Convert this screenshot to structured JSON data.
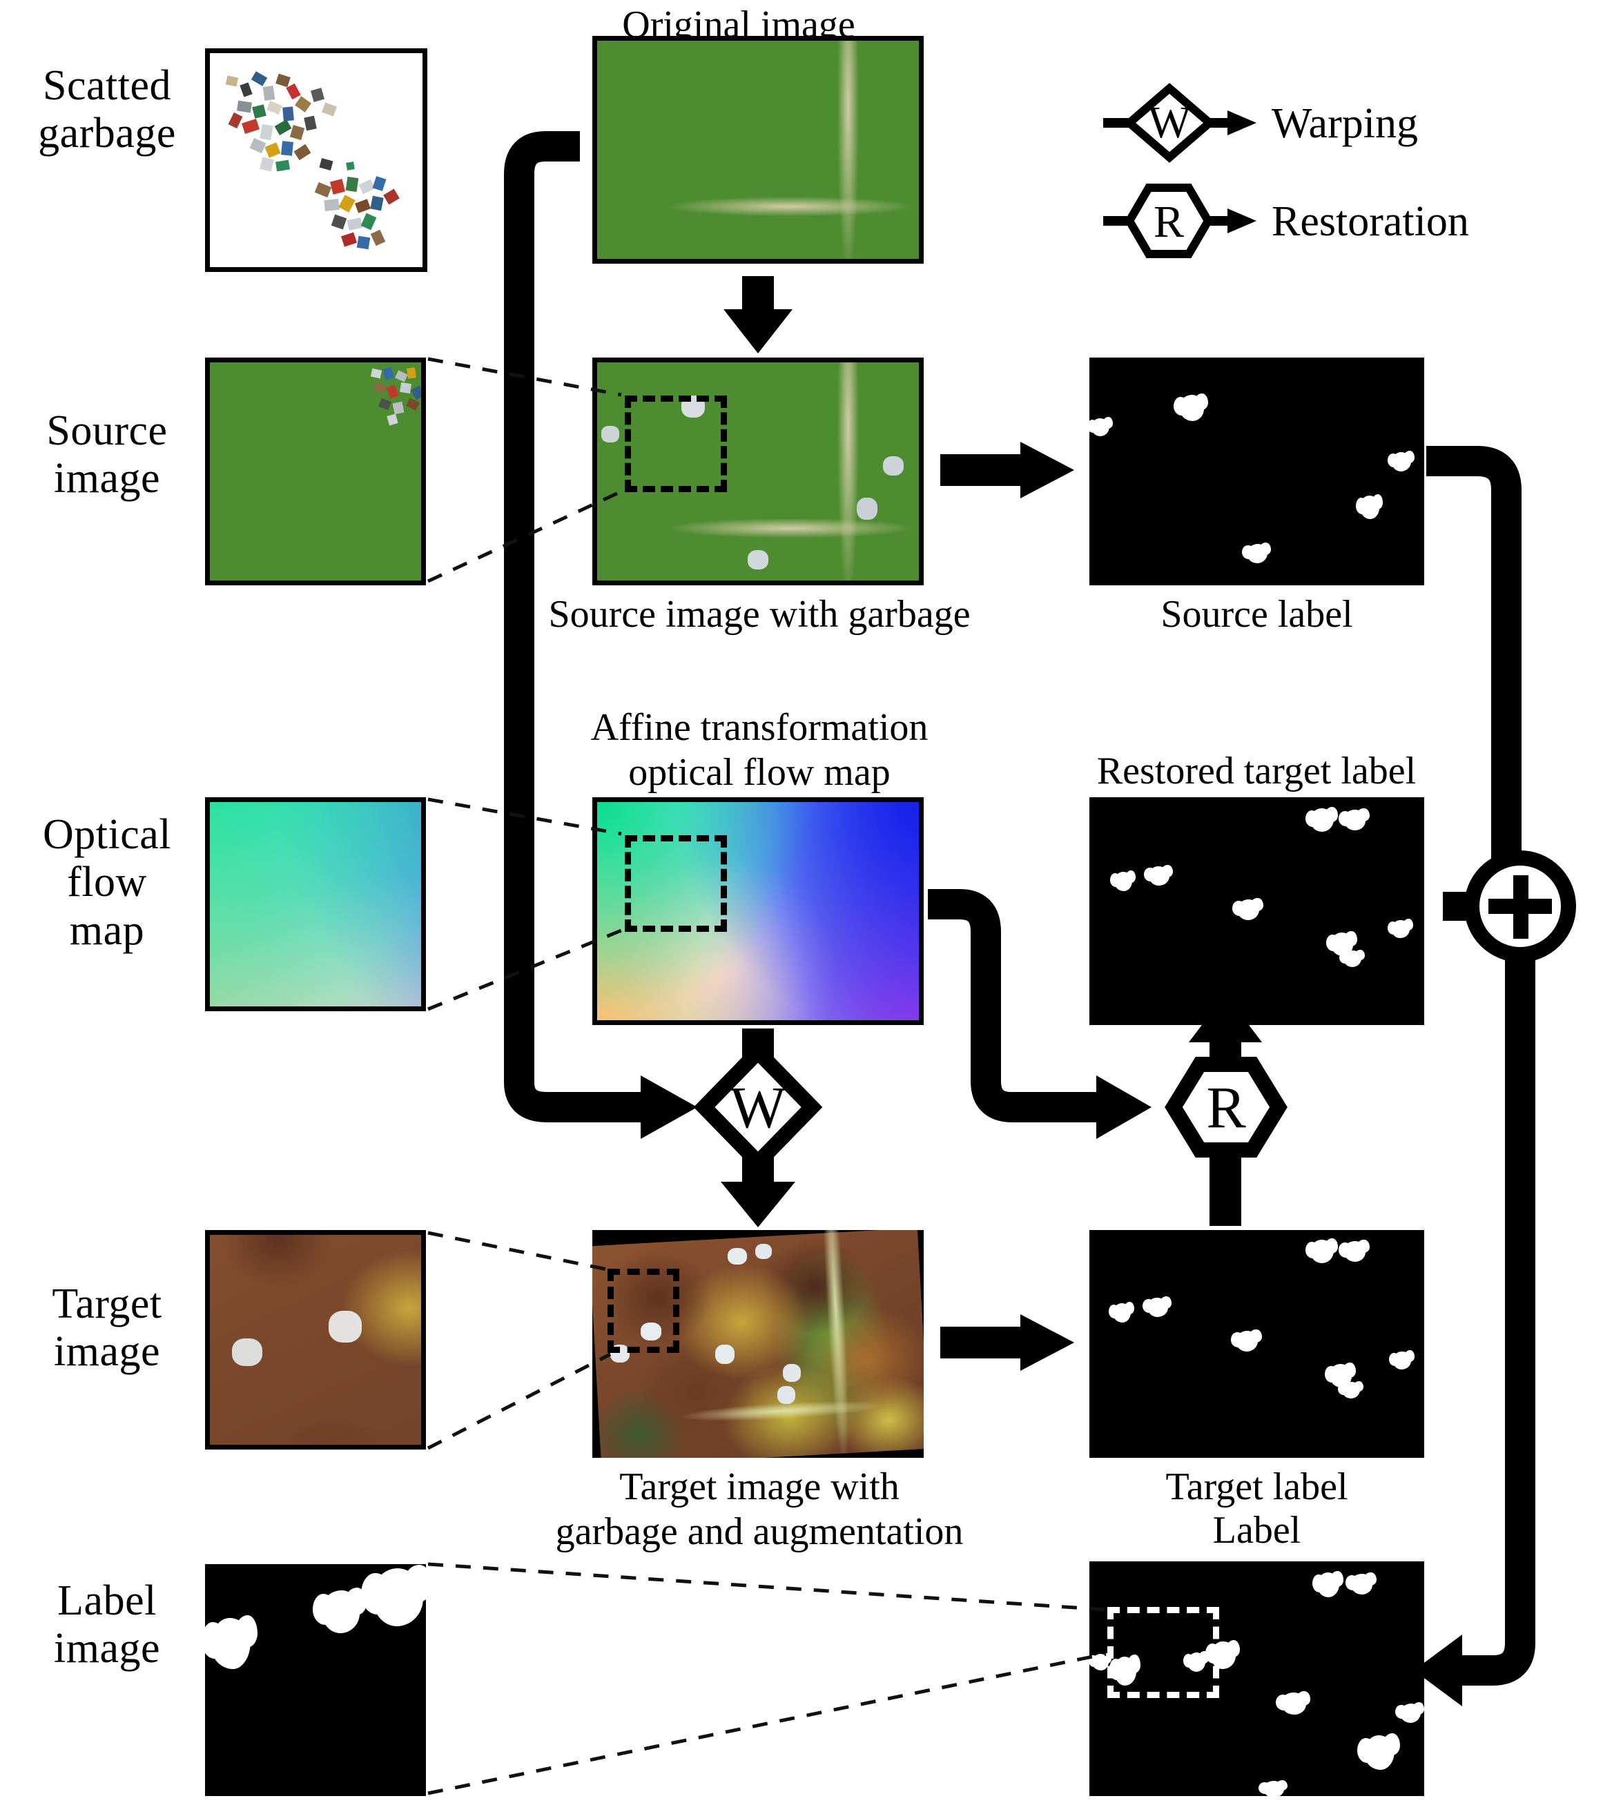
{
  "figure": {
    "type": "pipeline-diagram",
    "background": "#ffffff",
    "accent": "#000000"
  },
  "row_labels": [
    {
      "id": "scatted-garbage",
      "line1": "Scatted",
      "line2": "garbage"
    },
    {
      "id": "source-image",
      "line1": "Source",
      "line2": "image"
    },
    {
      "id": "optical-flow-map",
      "line1": "Optical",
      "line2": "flow",
      "line3": "map"
    },
    {
      "id": "target-image",
      "line1": "Target",
      "line2": "image"
    },
    {
      "id": "label-image",
      "line1": "Label",
      "line2": "image"
    }
  ],
  "captions": {
    "original_image": "Original image",
    "source_image_with_garbage": "Source image with garbage",
    "source_label": "Source label",
    "affine_flow_line1": "Affine transformation",
    "affine_flow_line2": "optical flow map",
    "restored_target_label": "Restored target label",
    "target_image_line1": "Target image with",
    "target_image_line2": "garbage and augmentation",
    "target_label": "Target label",
    "label": "Label"
  },
  "legend": {
    "items": [
      {
        "symbol": "W",
        "shape": "diamond",
        "label": "Warping"
      },
      {
        "symbol": "R",
        "shape": "hexagon",
        "label": "Restoration"
      }
    ]
  },
  "operators": {
    "warping": {
      "symbol": "W",
      "shape": "diamond"
    },
    "restoration": {
      "symbol": "R",
      "shape": "hexagon"
    },
    "combine": {
      "symbol": "+",
      "shape": "circle"
    }
  },
  "panels": {
    "scatted_garbage": {
      "kind": "garbage-patch",
      "border": "#000000",
      "fill": "#ffffff"
    },
    "source_patch": {
      "kind": "aerial-green-crop"
    },
    "source_image": {
      "kind": "aerial-green",
      "crop_box": true
    },
    "source_label": {
      "kind": "binary-mask",
      "bg": "#000000",
      "fg": "#ffffff",
      "blob_count": 6
    },
    "flow_patch": {
      "kind": "optical-flow-crop"
    },
    "flow_map": {
      "kind": "optical-flow",
      "crop_box": true
    },
    "restored_label": {
      "kind": "binary-mask",
      "bg": "#000000",
      "fg": "#ffffff",
      "blob_count": 8
    },
    "target_patch": {
      "kind": "aerial-brown-crop"
    },
    "target_image": {
      "kind": "aerial-brown-warped",
      "crop_box": true
    },
    "target_label": {
      "kind": "binary-mask",
      "bg": "#000000",
      "fg": "#ffffff",
      "blob_count": 8
    },
    "label_patch": {
      "kind": "binary-mask-crop",
      "bg": "#000000",
      "fg": "#ffffff",
      "blob_count": 3
    },
    "label_final": {
      "kind": "binary-mask",
      "bg": "#000000",
      "fg": "#ffffff",
      "blob_count": 10,
      "crop_box": true,
      "crop_box_color": "#ffffff"
    }
  },
  "flow_edges": [
    {
      "from": "original_image",
      "to": "source_image",
      "style": "thick-arrow-down"
    },
    {
      "from": "original_image",
      "to": "warping",
      "style": "thick-elbow"
    },
    {
      "from": "source_image",
      "to": "source_label",
      "style": "thick-arrow-right"
    },
    {
      "from": "flow_map",
      "to": "warping",
      "style": "thick-arrow-down"
    },
    {
      "from": "flow_map",
      "to": "restoration",
      "style": "thick-elbow-right"
    },
    {
      "from": "warping",
      "to": "target_image",
      "style": "thick-arrow-down"
    },
    {
      "from": "target_image",
      "to": "target_label",
      "style": "thick-arrow-right"
    },
    {
      "from": "target_label",
      "to": "restoration",
      "style": "thick-arrow-up"
    },
    {
      "from": "restoration",
      "to": "restored_label",
      "style": "thick-arrow-up"
    },
    {
      "from": "source_label",
      "to": "combine",
      "style": "thick-elbow-down"
    },
    {
      "from": "restored_label",
      "to": "combine",
      "style": "thick-arrow-right"
    },
    {
      "from": "combine",
      "to": "label_final",
      "style": "thick-elbow-arrow-left"
    }
  ]
}
